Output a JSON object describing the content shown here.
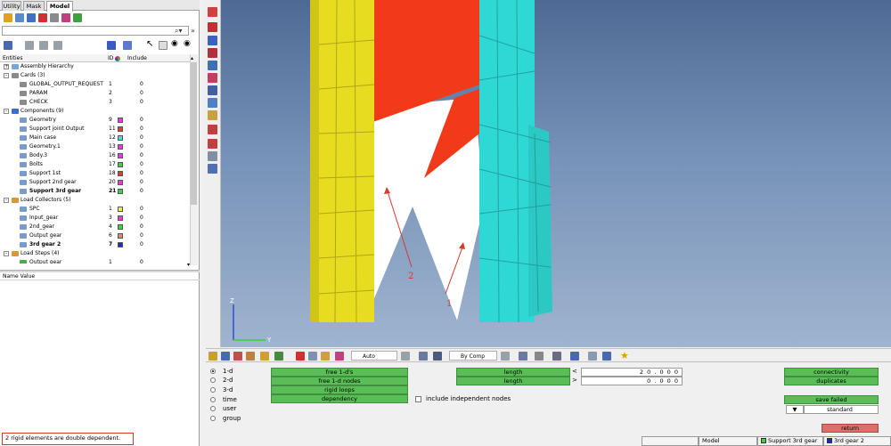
{
  "tabs": [
    "Utility",
    "Mask",
    "Model"
  ],
  "tree_header": {
    "entities": "Entities",
    "id": "ID",
    "include": "Include"
  },
  "tree": [
    {
      "label": "Assembly Hierarchy",
      "level": 0,
      "expander": "+",
      "icon_color": "#7aa7d9"
    },
    {
      "label": "Cards (3)",
      "level": 0,
      "expander": "-",
      "icon_color": "#8a8a8a"
    },
    {
      "label": "GLOBAL_OUTPUT_REQUEST",
      "level": 2,
      "id": "1",
      "include": "0",
      "icon_color": "#8a8a8a"
    },
    {
      "label": "PARAM",
      "level": 2,
      "id": "2",
      "include": "0",
      "icon_color": "#8a8a8a"
    },
    {
      "label": "CHECK",
      "level": 2,
      "id": "3",
      "include": "0",
      "icon_color": "#8a8a8a"
    },
    {
      "label": "Components (9)",
      "level": 0,
      "expander": "-",
      "icon_color": "#3a6fd0"
    },
    {
      "label": "Geometry",
      "level": 2,
      "id": "9",
      "swatch": "#e040e0",
      "include": "0",
      "icon_color": "#7a9ccc"
    },
    {
      "label": "Support joint Output",
      "level": 2,
      "id": "11",
      "swatch": "#e83a2a",
      "include": "0",
      "icon_color": "#7a9ccc"
    },
    {
      "label": "Main case",
      "level": 2,
      "id": "12",
      "swatch": "#40e0e0",
      "include": "0",
      "icon_color": "#7a9ccc"
    },
    {
      "label": "Geometry.1",
      "level": 2,
      "id": "13",
      "swatch": "#e040e0",
      "include": "0",
      "icon_color": "#7a9ccc"
    },
    {
      "label": "Body.3",
      "level": 2,
      "id": "16",
      "swatch": "#e040e0",
      "include": "0",
      "icon_color": "#7a9ccc"
    },
    {
      "label": "Bolts",
      "level": 2,
      "id": "17",
      "swatch": "#40d040",
      "include": "0",
      "icon_color": "#7a9ccc"
    },
    {
      "label": "Support 1st",
      "level": 2,
      "id": "18",
      "swatch": "#e83a2a",
      "include": "0",
      "icon_color": "#7a9ccc"
    },
    {
      "label": "Support 2nd gear",
      "level": 2,
      "id": "20",
      "swatch": "#e040e0",
      "include": "0",
      "icon_color": "#7a9ccc"
    },
    {
      "label": "Support 3rd gear",
      "level": 2,
      "id": "21",
      "swatch": "#40d040",
      "include": "0",
      "bold": true,
      "icon_color": "#7a9ccc"
    },
    {
      "label": "Load Collectors (5)",
      "level": 0,
      "expander": "-",
      "icon_color": "#d89a30"
    },
    {
      "label": "SPC",
      "level": 2,
      "id": "1",
      "swatch": "#f0f040",
      "include": "0",
      "icon_color": "#7a9ccc"
    },
    {
      "label": "Input_gear",
      "level": 2,
      "id": "3",
      "swatch": "#e040e0",
      "include": "0",
      "icon_color": "#7a9ccc"
    },
    {
      "label": "2nd_gear",
      "level": 2,
      "id": "4",
      "swatch": "#40d040",
      "include": "0",
      "icon_color": "#7a9ccc"
    },
    {
      "label": "Output gear",
      "level": 2,
      "id": "6",
      "swatch": "#e08a6a",
      "include": "0",
      "icon_color": "#7a9ccc"
    },
    {
      "label": "3rd gear 2",
      "level": 2,
      "id": "7",
      "swatch": "#1a2ad0",
      "include": "0",
      "bold": true,
      "icon_color": "#7a9ccc"
    },
    {
      "label": "Load Steps (4)",
      "level": 0,
      "expander": "-",
      "icon_color": "#d89a30"
    },
    {
      "label": "Output gear",
      "level": 2,
      "id": "1",
      "include": "0",
      "icon_color": "#40b040"
    }
  ],
  "name_value_header": "Name Value",
  "status_message": "2 rigid elements are double dependent.",
  "toolbar": {
    "auto_label": "Auto",
    "bycomp_label": "By Comp"
  },
  "annotations": {
    "label_left": "2",
    "label_right": "1"
  },
  "axis": {
    "z": "Z",
    "y": "Y"
  },
  "panel": {
    "radios": [
      {
        "label": "1-d",
        "selected": true
      },
      {
        "label": "2-d",
        "selected": false
      },
      {
        "label": "3-d",
        "selected": false
      },
      {
        "label": "time",
        "selected": false
      },
      {
        "label": "user",
        "selected": false
      },
      {
        "label": "group",
        "selected": false
      }
    ],
    "buttons_col1": [
      "free 1-d's",
      "free 1-d nodes",
      "rigid loops",
      "dependency"
    ],
    "include_independent_label": "include independent nodes",
    "length_buttons": [
      "length",
      "length"
    ],
    "comparators": [
      "<",
      ">"
    ],
    "length_values": [
      "2 0 .  0 0 0",
      "0 .  0 0 0"
    ],
    "right_buttons": [
      "connectivity",
      "duplicates"
    ],
    "save_failed": "save failed",
    "standard_dropdown": "standard",
    "dropdown_arrow": "▼",
    "return_button": "return"
  },
  "statusbar": {
    "model": "Model",
    "component": "Support 3rd gear",
    "component_color": "#40d040",
    "loadcol": "3rd gear 2",
    "loadcol_color": "#1a2ad0"
  },
  "colors": {
    "yellow_gear": "#e8dc20",
    "cyan_gear": "#2ed8d4",
    "red_part": "#f03a1a"
  }
}
